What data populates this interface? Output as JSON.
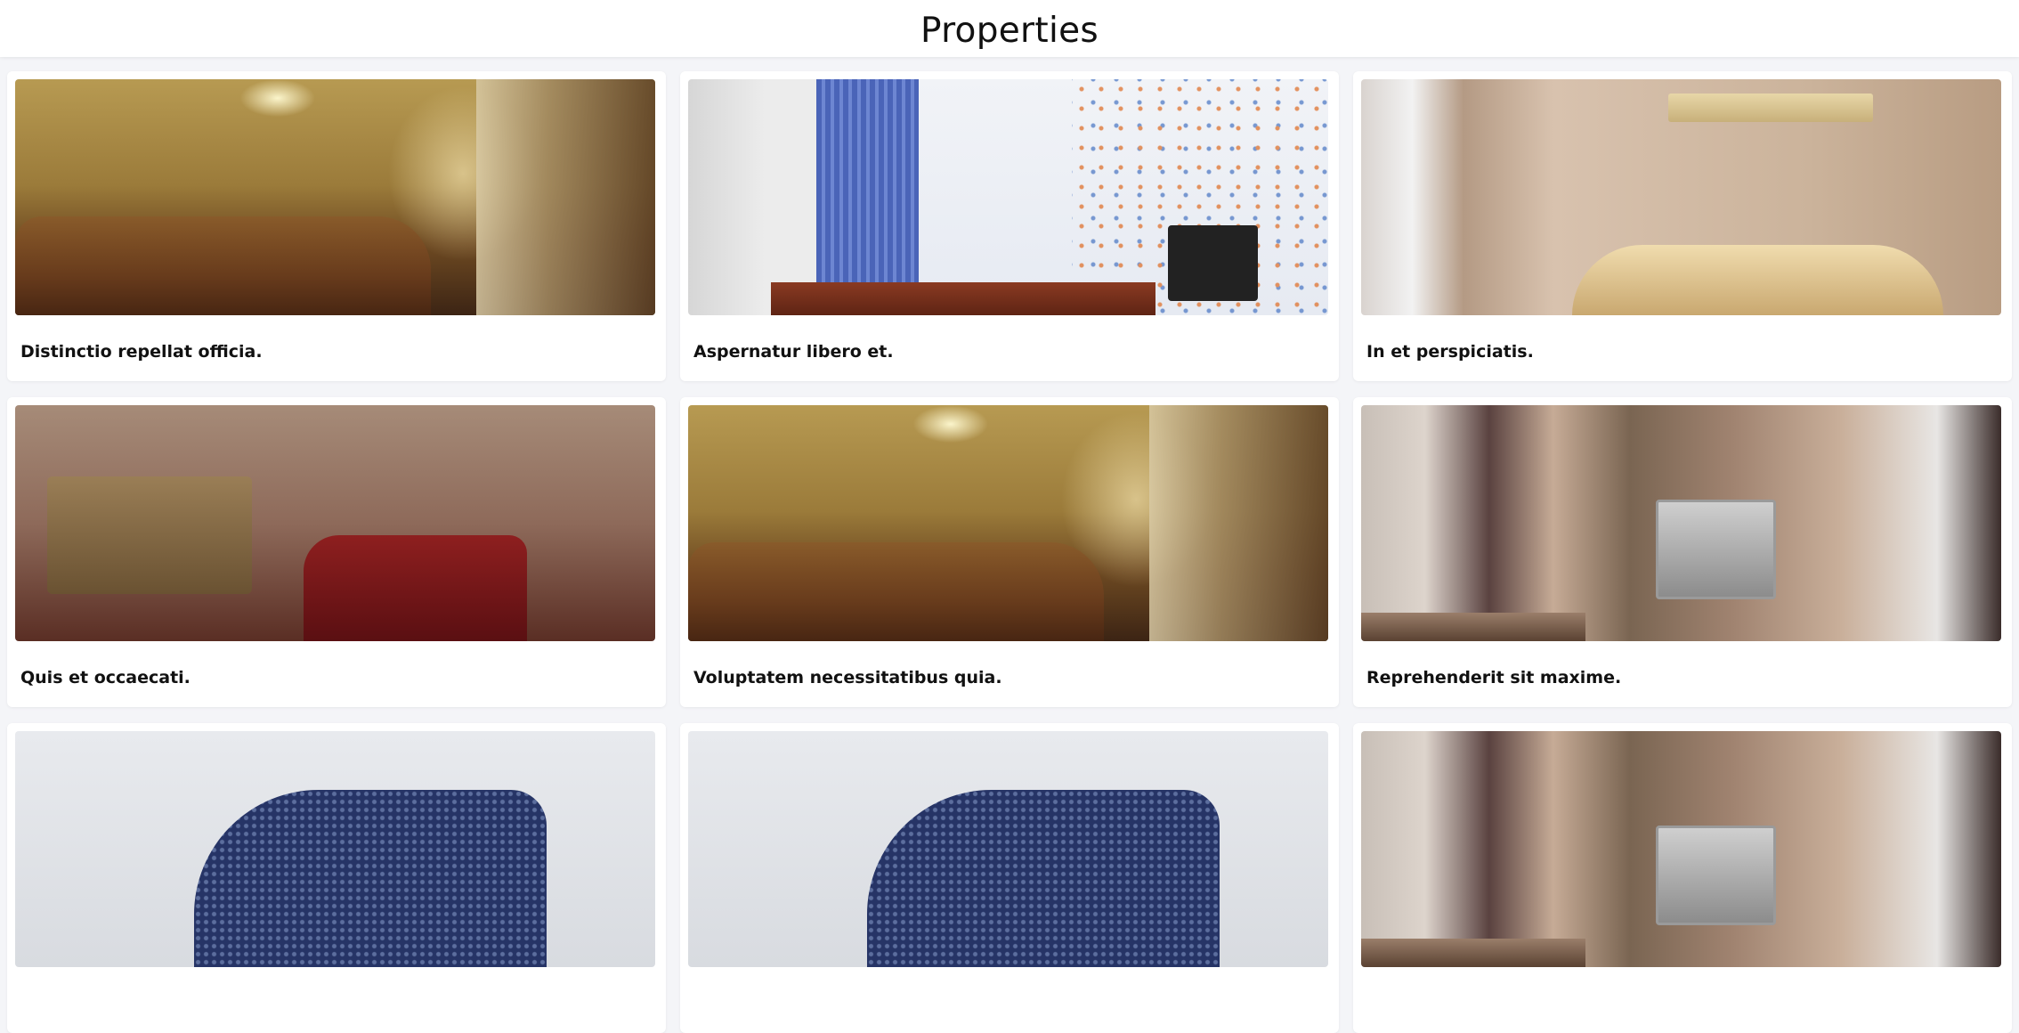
{
  "header": {
    "title": "Properties"
  },
  "properties": [
    {
      "title": "Distinctio repellat officia.",
      "image": "classic-bedroom-photo"
    },
    {
      "title": "Aspernatur libero et.",
      "image": "kids-room-photo"
    },
    {
      "title": "In et perspiciatis.",
      "image": "beige-sofa-room-photo"
    },
    {
      "title": "Quis et occaecati.",
      "image": "living-room-photo"
    },
    {
      "title": "Voluptatem necessitatibus quia.",
      "image": "classic-bedroom-photo"
    },
    {
      "title": "Reprehenderit sit maxime.",
      "image": "tv-room-photo"
    },
    {
      "title": "",
      "image": "bathroom-photo"
    },
    {
      "title": "",
      "image": "bathroom-photo"
    },
    {
      "title": "",
      "image": "tv-room-photo"
    }
  ]
}
